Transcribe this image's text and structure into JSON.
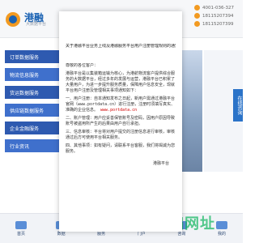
{
  "brand": {
    "logo_text": "港融",
    "logo_sub": "大数据平台"
  },
  "contacts": [
    {
      "label": "4001-036-327"
    },
    {
      "label": "18115207394"
    },
    {
      "label": "18115207399"
    }
  ],
  "left_menu": [
    {
      "label": "订单数据服务"
    },
    {
      "label": "物流信息服务"
    },
    {
      "label": "货运数据服务"
    },
    {
      "label": "供应链数据服务"
    },
    {
      "label": "企业金融服务"
    },
    {
      "label": "行业资讯"
    }
  ],
  "side_pill": {
    "label": "在线咨询"
  },
  "bottom_tabs": [
    {
      "label": "首页"
    },
    {
      "label": "数据"
    },
    {
      "label": "服务"
    },
    {
      "label": "门户"
    },
    {
      "label": "咨询"
    },
    {
      "label": "我的"
    }
  ],
  "watermark": {
    "text": "IZ 编网址"
  },
  "document": {
    "title": "关于港融平台业务上线及港融服务平台用户注册管理规则的通知",
    "greeting": "尊敬的各位客户：",
    "paragraphs": [
      {
        "text": "港融平台是以集装箱运输为核心，为港航物流客户提供综合服务的大数据平台，经过多年的发展与运营，港融平台已积累了大量用户，为进一步提升服务质量，保障用户信息安全，现就平台用户注册及管理相关事项通知如下："
      },
      {
        "text": "一、用户注册：自本通知发布之日起，新用户需通过港融平台官网（www.portdata.cn）进行注册，注册时须填写真实、准确的企业信息。",
        "highlight": "www.portdata.cn"
      },
      {
        "text": "二、账户管理：用户应妥善保管账号及密码，因用户原因导致账号被盗用所产生的后果由用户自行承担。"
      },
      {
        "text": "三、信息审核：平台将对用户提交的注册信息进行审核，审核通过后方可使用平台相关服务。"
      },
      {
        "text": "四、其他事项：如有疑问，请联系平台客服，我们将竭诚为您服务。"
      }
    ],
    "signature": "港融平台"
  }
}
